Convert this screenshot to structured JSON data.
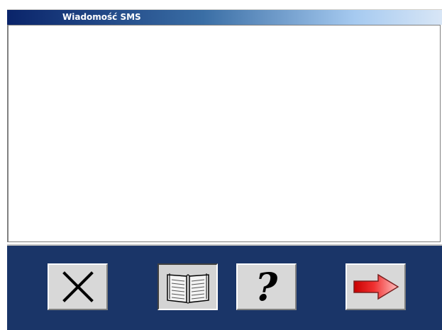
{
  "window": {
    "title": "Wiadomość SMS"
  },
  "message": {
    "value": "",
    "placeholder": ""
  },
  "toolbar": {
    "buttons": [
      {
        "id": "cancel",
        "icon": "close-icon"
      },
      {
        "id": "phonebook",
        "icon": "open-book-icon"
      },
      {
        "id": "help",
        "icon": "question-mark-icon",
        "glyph": "?"
      },
      {
        "id": "send",
        "icon": "red-arrow-right-icon"
      }
    ]
  },
  "colors": {
    "title_bar_start": "#0a246a",
    "title_bar_end": "#d8e6f6",
    "panel_background": "#1a3568",
    "button_face": "#d8d8d8",
    "send_arrow": "#e02020"
  }
}
